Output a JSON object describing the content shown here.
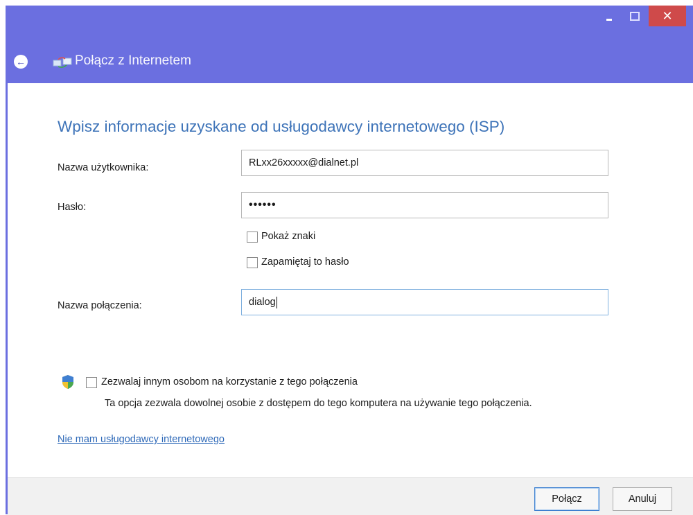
{
  "window": {
    "title": "Połącz z Internetem",
    "controls": {
      "close_glyph": "✕"
    }
  },
  "form": {
    "heading": "Wpisz informacje uzyskane od usługodawcy internetowego (ISP)",
    "username_label": "Nazwa użytkownika:",
    "username_value": "RLxx26xxxxx@dialnet.pl",
    "password_label": "Hasło:",
    "password_value": "••••••",
    "show_chars_label": "Pokaż znaki",
    "show_chars_checked": false,
    "remember_password_label": "Zapamiętaj to hasło",
    "remember_password_checked": false,
    "connection_name_label": "Nazwa połączenia:",
    "connection_name_value": "dialog",
    "share_label": "Zezwalaj innym osobom na korzystanie z tego połączenia",
    "share_checked": false,
    "share_description": "Ta opcja zezwala dowolnej osobie z dostępem do tego komputera na używanie tego połączenia.",
    "no_isp_link": "Nie mam usługodawcy internetowego"
  },
  "footer": {
    "connect_label": "Połącz",
    "cancel_label": "Anuluj"
  },
  "icons": {
    "back": "back-arrow-icon",
    "network": "network-connection-icon",
    "shield": "uac-shield-icon"
  },
  "colors": {
    "titlebar": "#6b6fe0",
    "heading": "#3d73b8",
    "close_button": "#cf4a4a",
    "link": "#2e69b8"
  }
}
